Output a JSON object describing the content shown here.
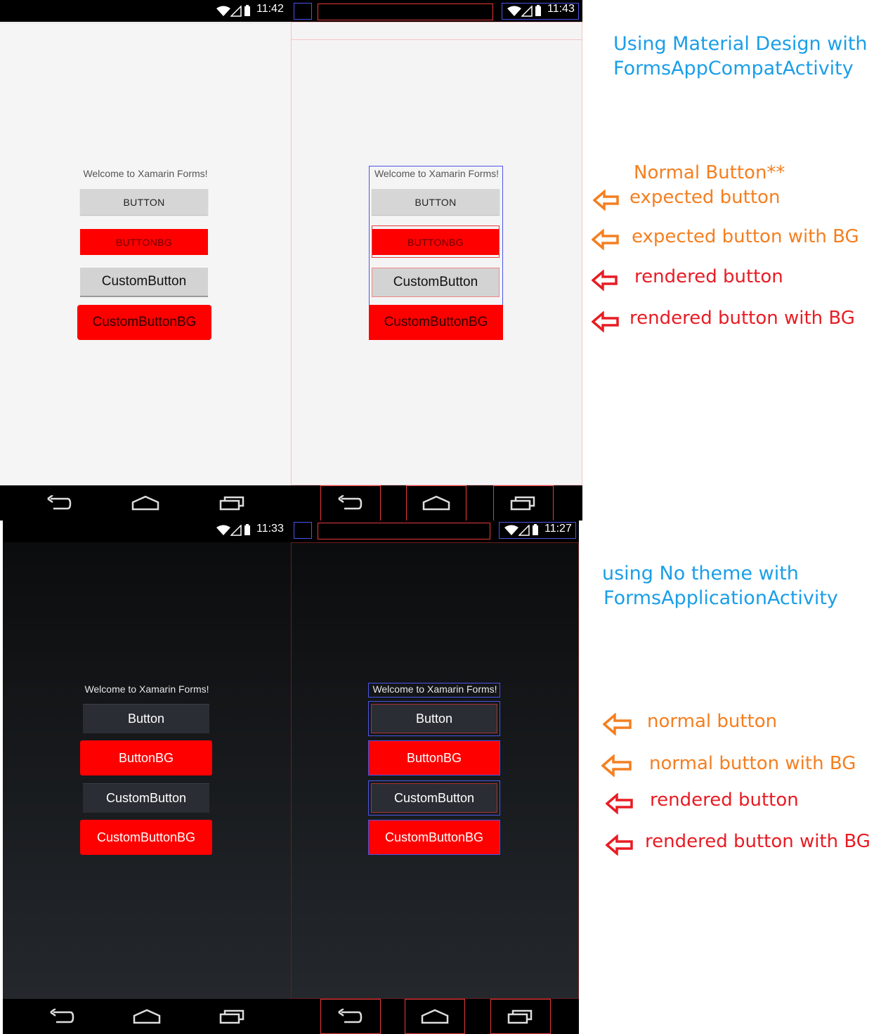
{
  "screens": [
    {
      "id": "material-design",
      "clock": "11:42",
      "welcome": "Welcome to Xamarin Forms!",
      "buttons": [
        "BUTTON",
        "BUTTONBG",
        "CustomButton",
        "CustomButtonBG"
      ]
    },
    {
      "id": "material-design-layout-bounds",
      "clock": "11:43",
      "welcome": "Welcome to Xamarin Forms!",
      "buttons": [
        "BUTTON",
        "BUTTONBG",
        "CustomButton",
        "CustomButtonBG"
      ]
    },
    {
      "id": "no-theme",
      "clock": "11:33",
      "welcome": "Welcome to Xamarin Forms!",
      "buttons": [
        "Button",
        "ButtonBG",
        "CustomButton",
        "CustomButtonBG"
      ]
    },
    {
      "id": "no-theme-layout-bounds",
      "clock": "11:27",
      "welcome": "Welcome to Xamarin Forms!",
      "buttons": [
        "Button",
        "ButtonBG",
        "CustomButton",
        "CustomButtonBG"
      ]
    }
  ],
  "annotations": {
    "top": {
      "heading_line1": "Using Material Design with",
      "heading_line2": "FormsAppCompatActivity",
      "subheading": "Normal Button**",
      "labels": [
        "expected button",
        "expected button with BG",
        "rendered button",
        "rendered button with BG"
      ]
    },
    "bottom": {
      "heading_line1": "using No theme with",
      "heading_line2": "FormsApplicationActivity",
      "labels": [
        "normal button",
        "normal button with BG",
        "rendered button",
        "rendered button with BG"
      ]
    }
  },
  "colors": {
    "heading": "#1a9ee8",
    "orange": "#f47f20",
    "red": "#e81c24",
    "button_bg": "#ff0000",
    "bounds_blue": "#4b55e8"
  },
  "icons": {
    "status": [
      "wifi-icon",
      "signal-icon",
      "battery-icon"
    ],
    "navigation": [
      "back-icon",
      "home-icon",
      "recents-icon"
    ],
    "annotation": "left-arrow-icon"
  }
}
